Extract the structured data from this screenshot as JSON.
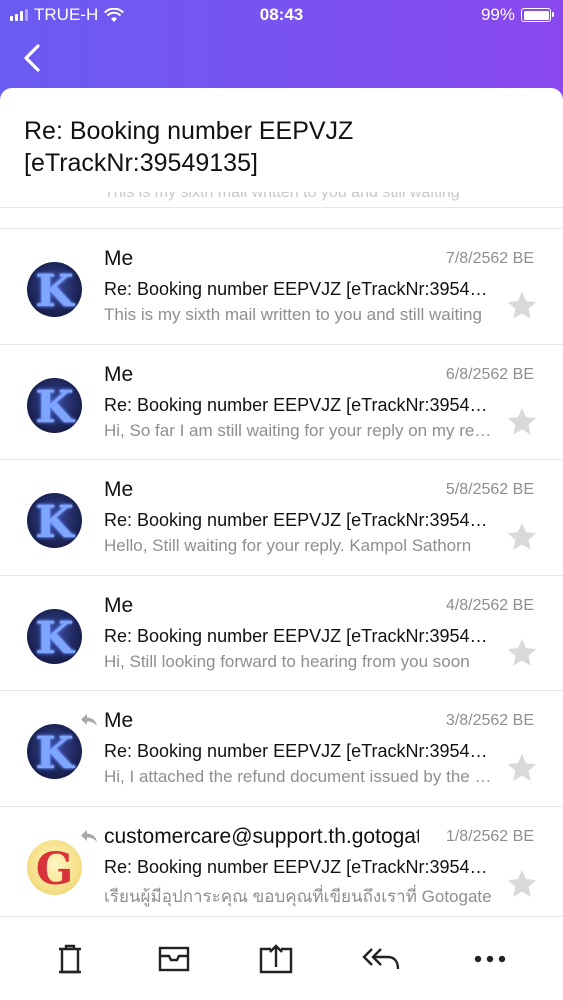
{
  "status_bar": {
    "carrier": "TRUE-H",
    "time": "08:43",
    "battery": "99%"
  },
  "nav": {
    "back_icon": "chevron-left-icon"
  },
  "thread": {
    "subject": "Re: Booking number EEPVJZ [eTrackNr:39549135]"
  },
  "messages": [
    {
      "sender": "Me",
      "date": "7/8/2562 BE",
      "subject": "Re: Booking number EEPVJZ [eTrackNr:39549135]",
      "preview": "This is my sixth mail written to you and still waiting",
      "avatar_letter": "K",
      "replied": false
    },
    {
      "sender": "Me",
      "date": "6/8/2562 BE",
      "subject": "Re: Booking number EEPVJZ [eTrackNr:39549135]",
      "preview": "Hi, So far I am still waiting for your reply on my refund",
      "avatar_letter": "K",
      "replied": false
    },
    {
      "sender": "Me",
      "date": "5/8/2562 BE",
      "subject": "Re: Booking number EEPVJZ [eTrackNr:39549135]",
      "preview": "Hello, Still waiting for your reply. Kampol Sathorn",
      "avatar_letter": "K",
      "replied": false
    },
    {
      "sender": "Me",
      "date": "4/8/2562 BE",
      "subject": "Re: Booking number EEPVJZ [eTrackNr:39549135]",
      "preview": "Hi, Still looking forward to hearing from you soon",
      "avatar_letter": "K",
      "replied": false
    },
    {
      "sender": "Me",
      "date": "3/8/2562 BE",
      "subject": "Re: Booking number EEPVJZ [eTrackNr:39549135]",
      "preview": "Hi, I attached the refund document issued by the bank",
      "avatar_letter": "K",
      "replied": true
    },
    {
      "sender": "customercare@support.th.gotogate.com",
      "date": "1/8/2562 BE",
      "subject": "Re: Booking number EEPVJZ [eTrackNr:39549135]",
      "preview": "เรียนผู้มีอุปการะคุณ ขอบคุณที่เขียนถึงเราที่ Gotogate",
      "avatar_letter": "G",
      "replied": true
    }
  ],
  "toolbar": {
    "items": [
      "trash-icon",
      "archive-icon",
      "move-icon",
      "reply-all-icon",
      "more-icon"
    ]
  },
  "colors": {
    "header_gradient_start": "#6a5cf0",
    "header_gradient_end": "#8a48ee",
    "secondary_text": "#8e8e93",
    "star": "#d9d9d9"
  }
}
